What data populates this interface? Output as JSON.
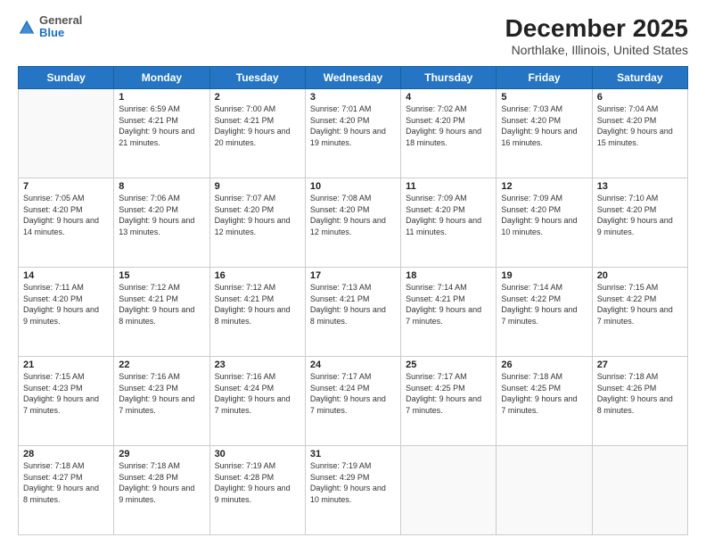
{
  "header": {
    "logo": {
      "general": "General",
      "blue": "Blue"
    },
    "title": "December 2025",
    "subtitle": "Northlake, Illinois, United States"
  },
  "weekdays": [
    "Sunday",
    "Monday",
    "Tuesday",
    "Wednesday",
    "Thursday",
    "Friday",
    "Saturday"
  ],
  "weeks": [
    [
      {
        "day": null
      },
      {
        "day": 1,
        "sunrise": "6:59 AM",
        "sunset": "4:21 PM",
        "daylight": "9 hours and 21 minutes."
      },
      {
        "day": 2,
        "sunrise": "7:00 AM",
        "sunset": "4:21 PM",
        "daylight": "9 hours and 20 minutes."
      },
      {
        "day": 3,
        "sunrise": "7:01 AM",
        "sunset": "4:20 PM",
        "daylight": "9 hours and 19 minutes."
      },
      {
        "day": 4,
        "sunrise": "7:02 AM",
        "sunset": "4:20 PM",
        "daylight": "9 hours and 18 minutes."
      },
      {
        "day": 5,
        "sunrise": "7:03 AM",
        "sunset": "4:20 PM",
        "daylight": "9 hours and 16 minutes."
      },
      {
        "day": 6,
        "sunrise": "7:04 AM",
        "sunset": "4:20 PM",
        "daylight": "9 hours and 15 minutes."
      }
    ],
    [
      {
        "day": 7,
        "sunrise": "7:05 AM",
        "sunset": "4:20 PM",
        "daylight": "9 hours and 14 minutes."
      },
      {
        "day": 8,
        "sunrise": "7:06 AM",
        "sunset": "4:20 PM",
        "daylight": "9 hours and 13 minutes."
      },
      {
        "day": 9,
        "sunrise": "7:07 AM",
        "sunset": "4:20 PM",
        "daylight": "9 hours and 12 minutes."
      },
      {
        "day": 10,
        "sunrise": "7:08 AM",
        "sunset": "4:20 PM",
        "daylight": "9 hours and 12 minutes."
      },
      {
        "day": 11,
        "sunrise": "7:09 AM",
        "sunset": "4:20 PM",
        "daylight": "9 hours and 11 minutes."
      },
      {
        "day": 12,
        "sunrise": "7:09 AM",
        "sunset": "4:20 PM",
        "daylight": "9 hours and 10 minutes."
      },
      {
        "day": 13,
        "sunrise": "7:10 AM",
        "sunset": "4:20 PM",
        "daylight": "9 hours and 9 minutes."
      }
    ],
    [
      {
        "day": 14,
        "sunrise": "7:11 AM",
        "sunset": "4:20 PM",
        "daylight": "9 hours and 9 minutes."
      },
      {
        "day": 15,
        "sunrise": "7:12 AM",
        "sunset": "4:21 PM",
        "daylight": "9 hours and 8 minutes."
      },
      {
        "day": 16,
        "sunrise": "7:12 AM",
        "sunset": "4:21 PM",
        "daylight": "9 hours and 8 minutes."
      },
      {
        "day": 17,
        "sunrise": "7:13 AM",
        "sunset": "4:21 PM",
        "daylight": "9 hours and 8 minutes."
      },
      {
        "day": 18,
        "sunrise": "7:14 AM",
        "sunset": "4:21 PM",
        "daylight": "9 hours and 7 minutes."
      },
      {
        "day": 19,
        "sunrise": "7:14 AM",
        "sunset": "4:22 PM",
        "daylight": "9 hours and 7 minutes."
      },
      {
        "day": 20,
        "sunrise": "7:15 AM",
        "sunset": "4:22 PM",
        "daylight": "9 hours and 7 minutes."
      }
    ],
    [
      {
        "day": 21,
        "sunrise": "7:15 AM",
        "sunset": "4:23 PM",
        "daylight": "9 hours and 7 minutes."
      },
      {
        "day": 22,
        "sunrise": "7:16 AM",
        "sunset": "4:23 PM",
        "daylight": "9 hours and 7 minutes."
      },
      {
        "day": 23,
        "sunrise": "7:16 AM",
        "sunset": "4:24 PM",
        "daylight": "9 hours and 7 minutes."
      },
      {
        "day": 24,
        "sunrise": "7:17 AM",
        "sunset": "4:24 PM",
        "daylight": "9 hours and 7 minutes."
      },
      {
        "day": 25,
        "sunrise": "7:17 AM",
        "sunset": "4:25 PM",
        "daylight": "9 hours and 7 minutes."
      },
      {
        "day": 26,
        "sunrise": "7:18 AM",
        "sunset": "4:25 PM",
        "daylight": "9 hours and 7 minutes."
      },
      {
        "day": 27,
        "sunrise": "7:18 AM",
        "sunset": "4:26 PM",
        "daylight": "9 hours and 8 minutes."
      }
    ],
    [
      {
        "day": 28,
        "sunrise": "7:18 AM",
        "sunset": "4:27 PM",
        "daylight": "9 hours and 8 minutes."
      },
      {
        "day": 29,
        "sunrise": "7:18 AM",
        "sunset": "4:28 PM",
        "daylight": "9 hours and 9 minutes."
      },
      {
        "day": 30,
        "sunrise": "7:19 AM",
        "sunset": "4:28 PM",
        "daylight": "9 hours and 9 minutes."
      },
      {
        "day": 31,
        "sunrise": "7:19 AM",
        "sunset": "4:29 PM",
        "daylight": "9 hours and 10 minutes."
      },
      {
        "day": null
      },
      {
        "day": null
      },
      {
        "day": null
      }
    ]
  ],
  "labels": {
    "sunrise": "Sunrise:",
    "sunset": "Sunset:",
    "daylight": "Daylight:"
  }
}
